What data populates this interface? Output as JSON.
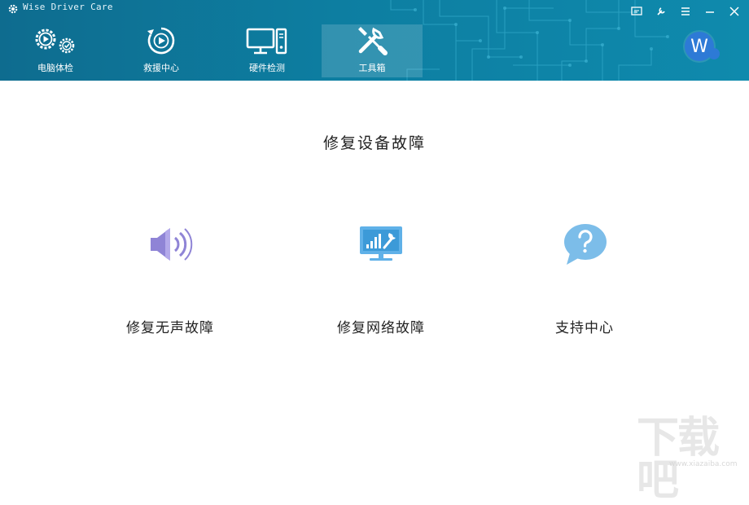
{
  "app": {
    "title": "Wise Driver Care"
  },
  "nav": {
    "tabs": [
      {
        "label": "电脑体检",
        "icon": "gears-play-icon"
      },
      {
        "label": "救援中心",
        "icon": "recovery-play-icon"
      },
      {
        "label": "硬件检测",
        "icon": "computer-tower-icon"
      },
      {
        "label": "工具箱",
        "icon": "wrench-screwdriver-icon",
        "active": true
      }
    ]
  },
  "window_controls": [
    "message-icon",
    "repair-icon",
    "menu-icon",
    "minimize-icon",
    "close-icon"
  ],
  "user": {
    "avatar_letter": "W"
  },
  "main": {
    "title": "修复设备故障",
    "tools": [
      {
        "label": "修复无声故障",
        "icon": "speaker-icon"
      },
      {
        "label": "修复网络故障",
        "icon": "monitor-network-icon"
      },
      {
        "label": "支持中心",
        "icon": "question-bubble-icon"
      }
    ]
  },
  "watermark": {
    "text": "下载吧",
    "url": "www.xiazaiba.com"
  },
  "colors": {
    "header": "#0e7a9e",
    "accent_purple": "#8f84d6",
    "accent_blue": "#5fb1e8"
  }
}
